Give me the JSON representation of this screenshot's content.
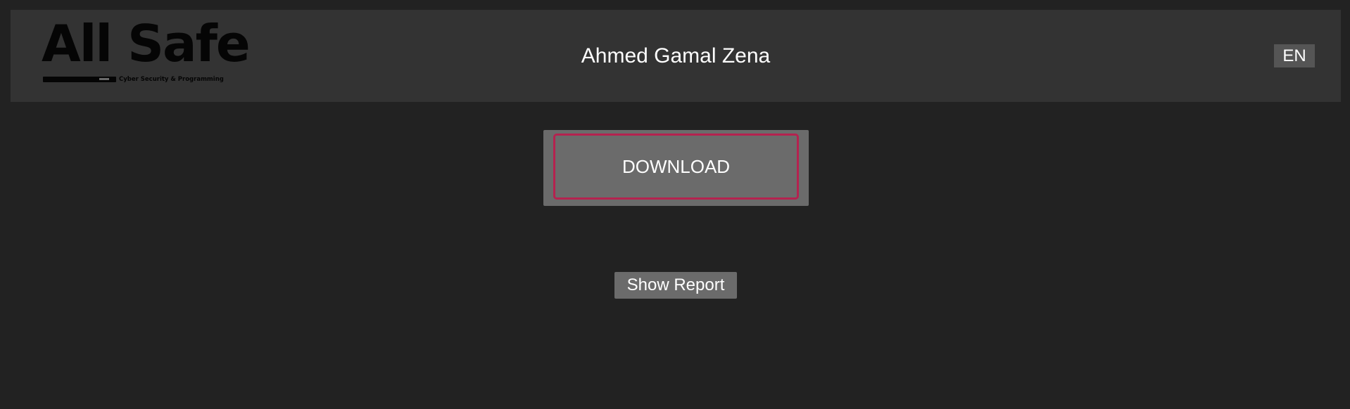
{
  "header": {
    "logo": {
      "name": "All Safe",
      "tagline": "Cyber Security & Programming"
    },
    "title": "Ahmed Gamal Zena",
    "language_button": "EN"
  },
  "main": {
    "download_label": "DOWNLOAD",
    "show_report_label": "Show Report"
  },
  "colors": {
    "background": "#222222",
    "header_background": "#333333",
    "button_background": "#6b6b6b",
    "accent_border": "#b5224f",
    "language_button_background": "#555555"
  }
}
